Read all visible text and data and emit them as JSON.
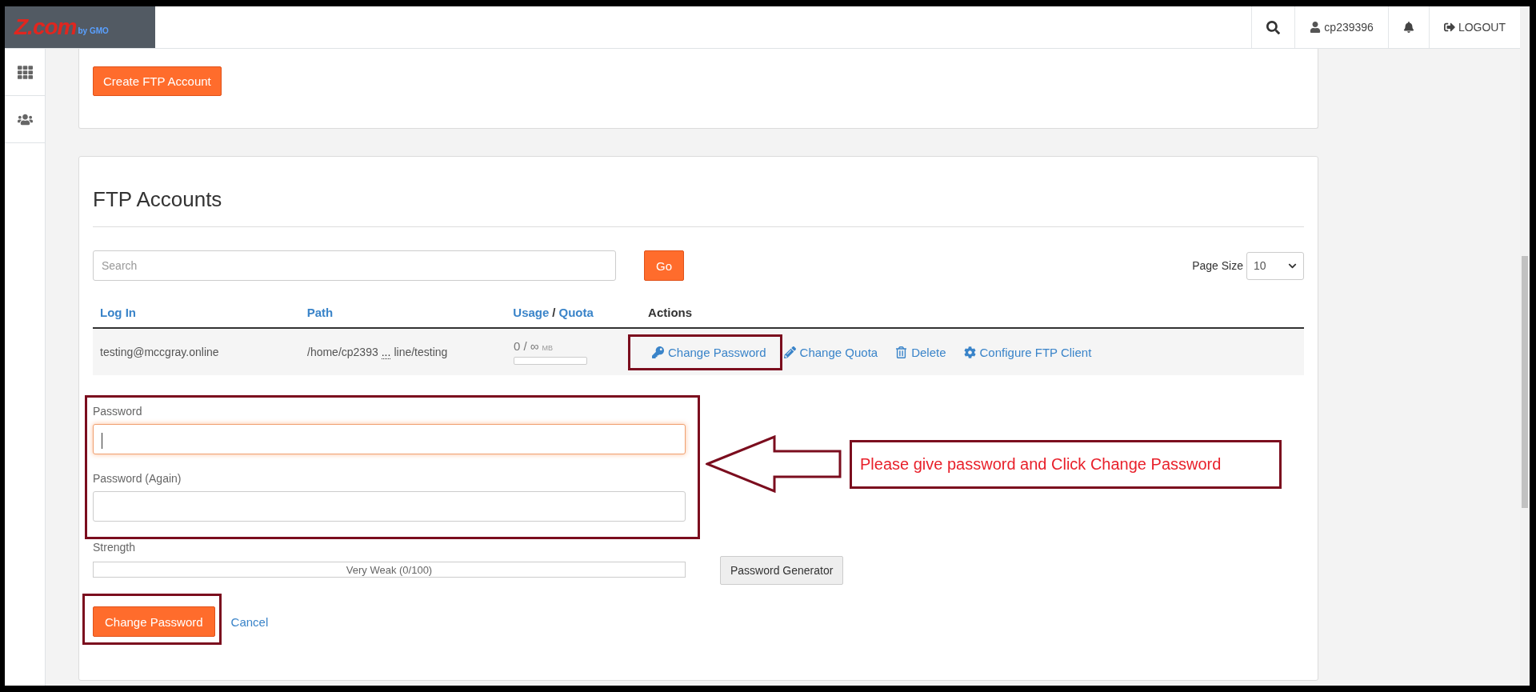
{
  "header": {
    "logo": {
      "name": "Z.com",
      "sub": "by GMO"
    },
    "user": "cp239396",
    "logout": "LOGOUT"
  },
  "sidebar": {
    "items": [
      {
        "kind": "apps",
        "selected": false
      },
      {
        "kind": "users",
        "selected": false
      }
    ]
  },
  "create_button": "Create FTP Account",
  "ftp_accounts": {
    "title": "FTP Accounts",
    "search": {
      "placeholder": "Search"
    },
    "go": "Go",
    "page_size": {
      "label": "Page Size",
      "value": "10"
    },
    "columns": [
      {
        "label": "Log In",
        "sortable": true
      },
      {
        "label": "Path",
        "sortable": true
      },
      {
        "label": "Usage",
        "sep": "/",
        "label2": "Quota",
        "sortable": true
      },
      {
        "label": "Actions",
        "sortable": false
      }
    ],
    "rows": [
      {
        "login": "testing@mccgray.online",
        "path_start": "/home/cp2393",
        "ellipsis": "...",
        "path_end": "line/testing",
        "usage": "0 / ∞",
        "unit": "MB",
        "level": 0,
        "actions": [
          {
            "kind": "key",
            "label": "Change Password",
            "highlighted": true
          },
          {
            "kind": "pencil",
            "label": "Change Quota",
            "highlighted": false
          },
          {
            "kind": "trash",
            "label": "Delete",
            "highlighted": false
          },
          {
            "kind": "gear",
            "label": "Configure FTP Client",
            "highlighted": false
          }
        ]
      }
    ]
  },
  "form": {
    "password": {
      "label": "Password",
      "focused": true
    },
    "password_again": {
      "label": "Password (Again)",
      "focused": false
    },
    "fields_highlighted": true,
    "strength": {
      "label": "Strength",
      "text": "Very Weak (0/100)",
      "level": 0
    },
    "generator": "Password Generator",
    "submit": "Change Password",
    "submit_highlighted": true,
    "cancel": "Cancel"
  },
  "callout": {
    "text": "Please give password and Click Change Password"
  }
}
